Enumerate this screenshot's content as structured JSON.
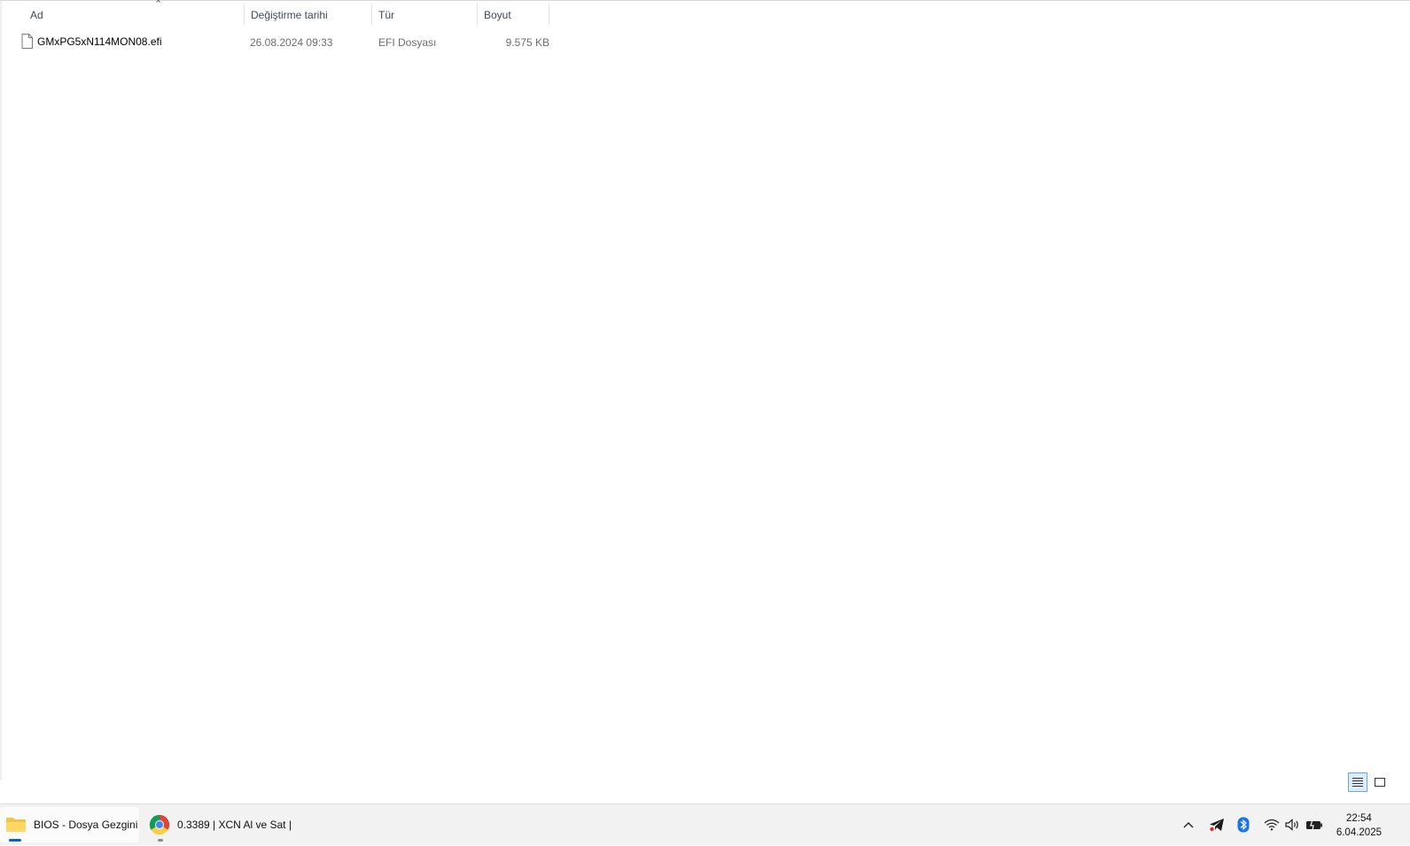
{
  "columns": {
    "name": "Ad",
    "date": "Değiştirme tarihi",
    "type": "Tür",
    "size": "Boyut"
  },
  "files": [
    {
      "name": "GMxPG5xN114MON08.efi",
      "date": "26.08.2024 09:33",
      "type": "EFI Dosyası",
      "size": "9.575 KB",
      "icon": "file-icon"
    }
  ],
  "taskbar": {
    "apps": [
      {
        "label": "BIOS - Dosya Gezgini",
        "icon": "folder-icon",
        "accent": "#0067c0"
      },
      {
        "label": "0.3389 | XCN Al ve Sat |",
        "icon": "chrome-icon",
        "accent": "#8a8a8a"
      }
    ],
    "clock": {
      "time": "22:54",
      "date": "6.04.2025"
    },
    "tray_icons": [
      "chevron-up-icon",
      "telegram-icon",
      "bluetooth-icon",
      "wifi-icon",
      "volume-icon",
      "battery-icon"
    ]
  },
  "colors": {
    "accent": "#0067c0",
    "telegram": "#1b1b1b",
    "bluetooth": "#1a73e8"
  }
}
